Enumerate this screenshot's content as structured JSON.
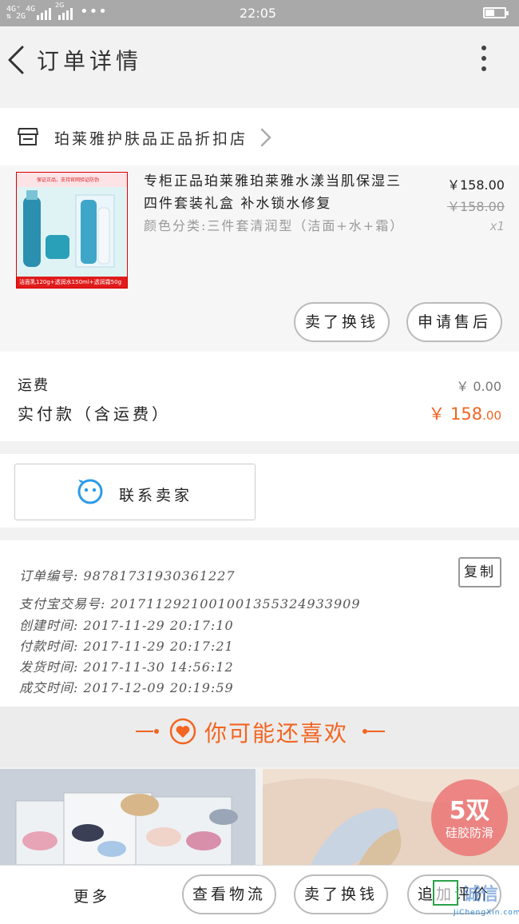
{
  "status_bar": {
    "signal_left": "4G⁺ 4G\n⇅ 2G",
    "signal_mid": "2G",
    "dots": "•••",
    "time": "22:05"
  },
  "header": {
    "title": "订单详情"
  },
  "shop": {
    "name": "珀莱雅护肤品正品折扣店"
  },
  "product": {
    "image_top_text": "保证正品，支持官网验证防伪",
    "image_bottom_text": "洁面乳120g+透润水150ml+透润霜50g",
    "name": "专柜正品珀莱雅珀莱雅水漾当肌保湿三四件套装礼盒 补水锁水修复",
    "sku": "颜色分类:三件套清润型（洁面+水+霜）",
    "price": "￥158.00",
    "original_price": "￥158.00",
    "quantity": "x1",
    "buttons": {
      "exchange": "卖了换钱",
      "after_sale": "申请售后"
    }
  },
  "totals": {
    "shipping_label": "运费",
    "shipping_value": "￥ 0.00",
    "paid_label": "实付款（含运费）",
    "paid_symbol": "￥",
    "paid_integer": "158",
    "paid_decimal": ".00"
  },
  "contact": {
    "label": "联系卖家"
  },
  "order_info": {
    "order_no": "订单编号: 98781731930361227",
    "alipay_no": "支付宝交易号: 2017112921001001355324933909",
    "created": "创建时间: 2017-11-29 20:17:10",
    "paid": "付款时间: 2017-11-29 20:17:21",
    "shipped": "发货时间: 2017-11-30 14:56:12",
    "completed": "成交时间: 2017-12-09 20:19:59",
    "copy_label": "复制"
  },
  "recommend": {
    "title": "你可能还喜欢",
    "badge_big": "5双",
    "badge_small": "硅胶防滑"
  },
  "bottom_bar": {
    "more": "更多",
    "logistics": "查看物流",
    "exchange": "卖了换钱",
    "review": "追加评价"
  },
  "watermark": {
    "text": "诚信",
    "url": "JiChengXin.com"
  },
  "colors": {
    "accent": "#f26522",
    "status_bar": "#a9a9a9",
    "chat_icon": "#2b9be8"
  }
}
